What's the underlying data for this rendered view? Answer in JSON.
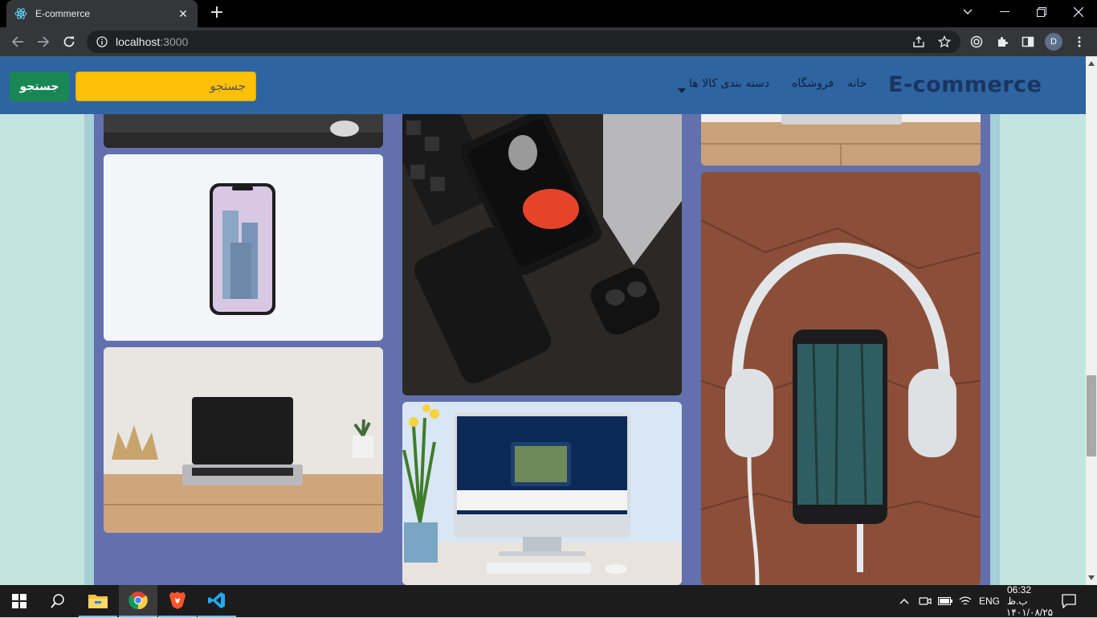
{
  "browser": {
    "tab_title": "E-commerce",
    "tab_close": "✕",
    "new_tab": "+",
    "url_host": "localhost",
    "url_port": ":3000",
    "profile_initial": "D"
  },
  "navbar": {
    "brand": "E-commerce",
    "links": [
      "خانه",
      "فروشگاه",
      "دسته بندی کالا ها"
    ],
    "search_placeholder": "جستجو",
    "search_button": "جستجو",
    "colors": {
      "navbar": "#2e64a0",
      "search_input": "#ffc107",
      "search_button": "#198754"
    }
  },
  "gallery": {
    "images": [
      "laptop-desk-partial",
      "phone-white-background",
      "laptop-on-desk",
      "phone-keyboard-powerbank-earbuds",
      "imac-on-desk",
      "desk-partial",
      "headphones-phone-leather"
    ]
  },
  "taskbar": {
    "apps": [
      "file-explorer",
      "chrome",
      "brave",
      "vscode"
    ],
    "lang": "ENG",
    "time": "06:32 ب.ظ",
    "date": "۱۴۰۱/۰۸/۲۵"
  }
}
